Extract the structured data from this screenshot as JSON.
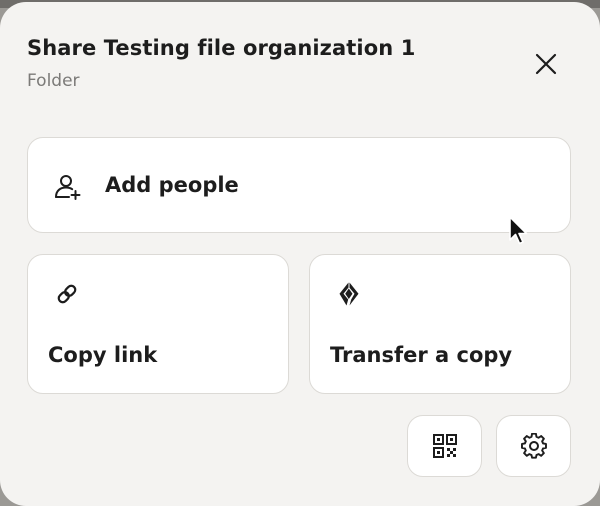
{
  "dialog": {
    "title": "Share Testing file organization 1",
    "subtitle": "Folder"
  },
  "actions": {
    "add_people_label": "Add people",
    "copy_link_label": "Copy link",
    "transfer_label": "Transfer a copy"
  },
  "icons": {
    "close": "close-icon",
    "add_people": "user-plus-icon",
    "copy_link": "link-icon",
    "transfer": "transfer-logo-icon",
    "qr": "qr-code-icon",
    "settings": "gear-icon"
  },
  "colors": {
    "dialog_bg": "#f4f3f1",
    "card_bg": "#ffffff",
    "card_border": "#dcdad6",
    "text_primary": "#1d1d1d",
    "text_secondary": "#7b7a78"
  }
}
